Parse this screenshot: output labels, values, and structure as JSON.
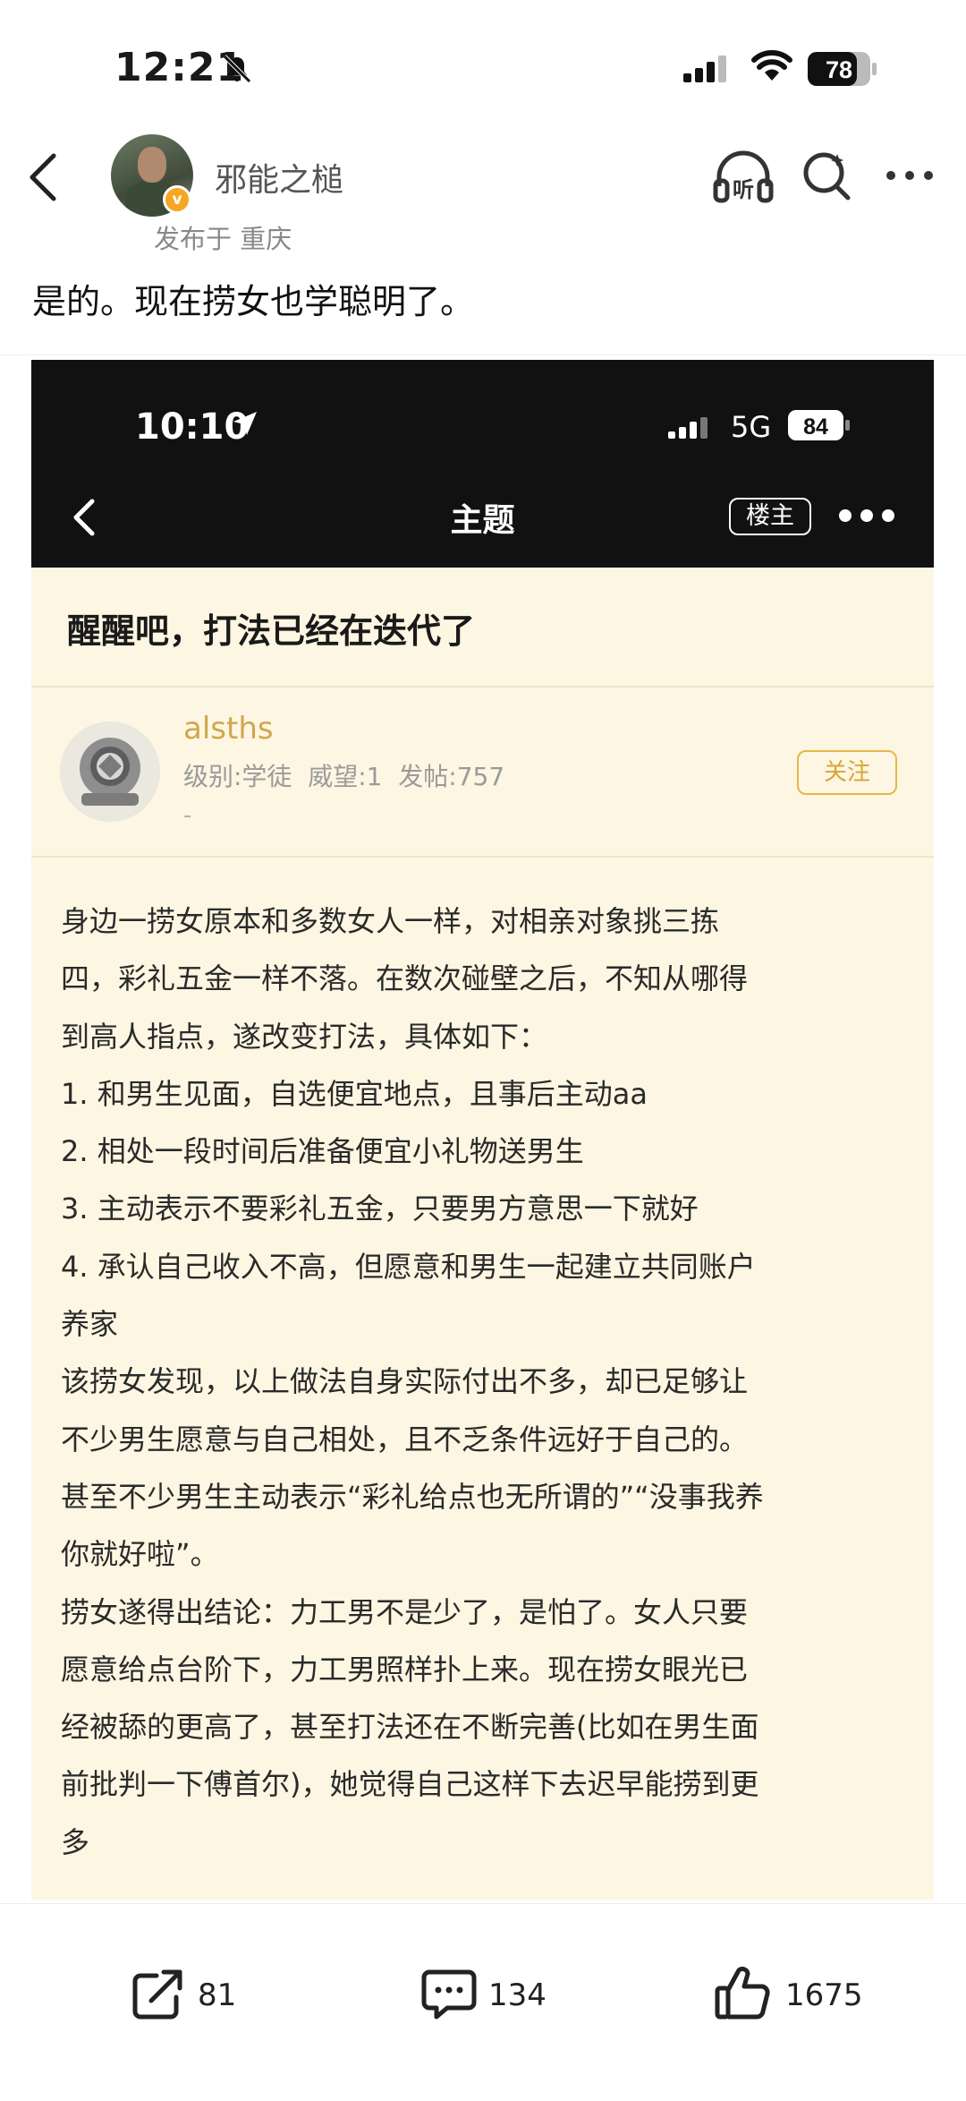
{
  "status_bar": {
    "time": "12:21",
    "battery": "78"
  },
  "header": {
    "author_name": "邪能之槌",
    "verified_badge": "v",
    "location": "发布于 重庆",
    "listen_label": "听"
  },
  "post": {
    "text": "是的。现在捞女也学聪明了。"
  },
  "embedded_screenshot": {
    "status_bar": {
      "time": "10:10",
      "network": "5G",
      "battery": "84"
    },
    "nav": {
      "title": "主题",
      "op_tag": "楼主"
    },
    "thread_title": "醒醒吧，打法已经在迭代了",
    "user": {
      "name": "alsths",
      "meta": "级别:学徒  威望:1  发帖:757",
      "signature": "-",
      "follow_label": "关注"
    },
    "body_lines": [
      "身边一捞女原本和多数女人一样，对相亲对象挑三拣",
      "四，彩礼五金一样不落。在数次碰壁之后，不知从哪得",
      "到高人指点，遂改变打法，具体如下：",
      "1. 和男生见面，自选便宜地点，且事后主动aa",
      "2. 相处一段时间后准备便宜小礼物送男生",
      "3. 主动表示不要彩礼五金，只要男方意思一下就好",
      "4. 承认自己收入不高，但愿意和男生一起建立共同账户",
      "养家",
      "该捞女发现，以上做法自身实际付出不多，却已足够让",
      "不少男生愿意与自己相处，且不乏条件远好于自己的。",
      "甚至不少男生主动表示“彩礼给点也无所谓的”“没事我养",
      "你就好啦”。",
      "捞女遂得出结论：力工男不是少了，是怕了。女人只要",
      "愿意给点台阶下，力工男照样扑上来。现在捞女眼光已",
      "经被舔的更高了，甚至打法还在不断完善(比如在男生面",
      "前批判一下傅首尔)，她觉得自己这样下去迟早能捞到更",
      "多"
    ]
  },
  "actions": {
    "share_count": "81",
    "comment_count": "134",
    "like_count": "1675"
  },
  "colors": {
    "username_gold": "#cfa84f",
    "follow_gold": "#d9a533",
    "embed_bg": "#fdf6e2"
  }
}
